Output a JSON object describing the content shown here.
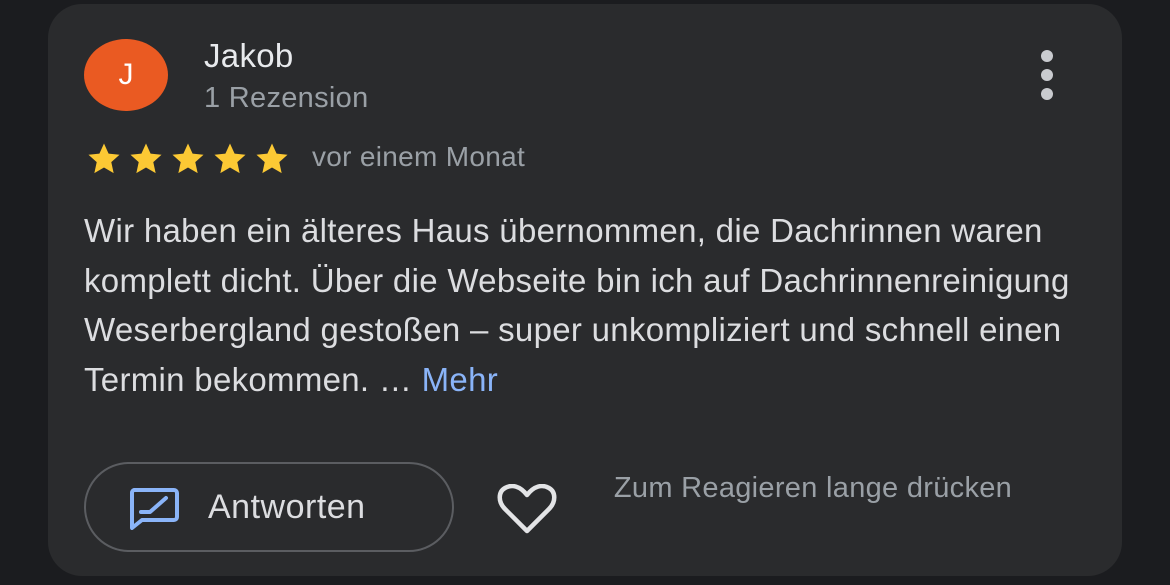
{
  "review": {
    "author_initial": "J",
    "author_name": "Jakob",
    "author_meta": "1 Rezension",
    "rating": 5,
    "rating_max": 5,
    "date": "vor einem Monat",
    "text": "Wir haben ein älteres Haus übernommen, die Dachrinnen waren komplett dicht. Über die Webseite bin ich auf Dachrinnenreinigung Weserbergland gestoßen – super unkompliziert und schnell einen Termin bekommen. … ",
    "more_label": "Mehr"
  },
  "actions": {
    "reply_label": "Antworten",
    "react_hint": "Zum Reagieren lange drücken"
  },
  "icons": {
    "menu": "more-vert-icon",
    "star": "star-icon",
    "reply": "reply-edit-icon",
    "like": "heart-outline-icon"
  },
  "colors": {
    "avatar_bg": "#ea5a22",
    "star": "#fcc934",
    "link": "#8ab4f8",
    "reply_icon": "#8ab4f8"
  }
}
